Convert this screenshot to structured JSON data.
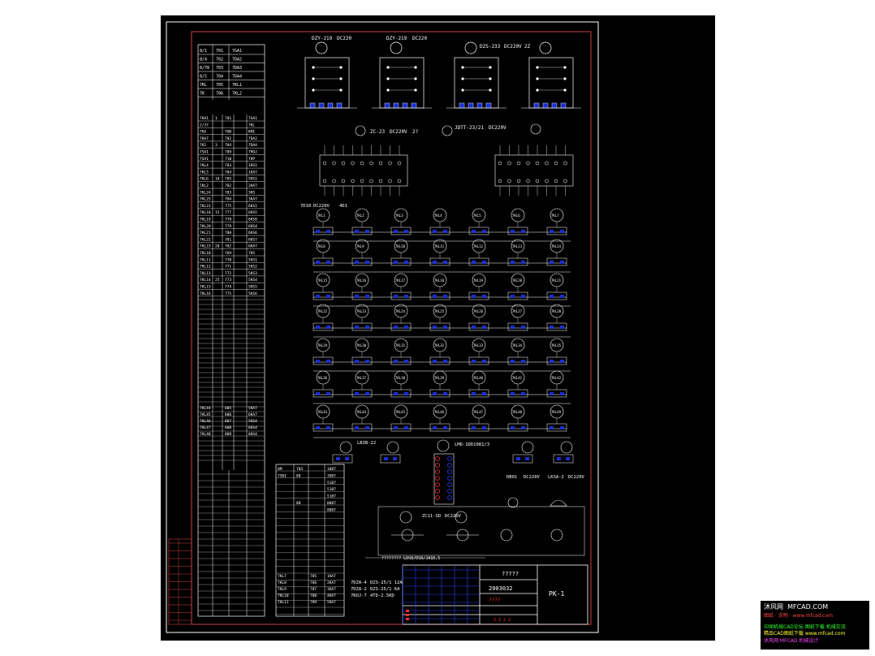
{
  "drawing": {
    "title": "?????",
    "drawing_no": "2003032",
    "sheet_code": "PK-1",
    "revision_marks": [
      "????",
      "2 2 2 2"
    ]
  },
  "relays": {
    "top_types": [
      "DZY-219",
      "DC220",
      "DZY-219",
      "DC220",
      "DZS-233",
      "DC220V",
      "2Z"
    ],
    "mid_types": [
      "ZC-23",
      "DC220V",
      "2?",
      "JDTT-23/21",
      "DC220V"
    ],
    "row_label": [
      "7D10",
      "DC220V",
      "4D1"
    ],
    "bottom_types": [
      "LBIB-22",
      "LMD-1DD1081/3"
    ],
    "bottom_right_types": [
      "DB01",
      "DC220V",
      "LKSA-2",
      "DC220V"
    ],
    "contactor_type": "ZC11-SD",
    "contactor_label": "DC220V",
    "bottom_caption": "???????? LDS8/DS8/JA1D,5"
  },
  "equipment_legend": [
    {
      "tag": "7DZA-4",
      "desc": "DZS-25/1 12A"
    },
    {
      "tag": "7DZA-2",
      "desc": "DZS-25/1 6A"
    },
    {
      "tag": "7ROJ-7",
      "desc": "4TD-2.5RD"
    }
  ],
  "relay_tags": {
    "row1": [
      "7KL1",
      "7KL2",
      "7KL3",
      "7KL4",
      "7KL5",
      "7KL6",
      "7KL7"
    ],
    "row2": [
      "7KL8",
      "7KL9",
      "7KL10",
      "7KL11",
      "7KL12",
      "7KL13",
      "7KL14"
    ],
    "row3": [
      "7KL15",
      "7KL16",
      "7KL17",
      "7KL18",
      "7KL19",
      "7KL20",
      "7KL21"
    ],
    "row4": [
      "7KL22",
      "7KL23",
      "7KL24",
      "7KL25",
      "7KL26",
      "7KL27",
      "7KL28"
    ],
    "row5": [
      "7KL29",
      "7KL30",
      "7KL31",
      "7KL32",
      "7KL33",
      "7KL34",
      "7KL35"
    ],
    "row6": [
      "7KL36",
      "7KL37",
      "7KL38",
      "7KL39",
      "7KL40",
      "7KL41",
      "7KL42"
    ],
    "row7": [
      "7KL43",
      "7KL44",
      "7KL45",
      "7KL46",
      "7KL47",
      "7KL48",
      "7KL49"
    ]
  },
  "terminal_table_rows": [
    [
      "7KA1",
      "1",
      "701",
      "7GA1"
    ],
    [
      "2/37",
      "",
      "",
      "7KL"
    ],
    [
      "7KA",
      "",
      "700",
      "KM1"
    ],
    [
      "7KA7",
      "",
      "702",
      "7DA2"
    ],
    [
      "7K2",
      "3",
      "704",
      "7DA4"
    ],
    [
      "7SA1",
      "",
      "709",
      "7ROJ"
    ],
    [
      "7SA1",
      "",
      "710",
      "7KP"
    ],
    [
      "7KL4",
      "",
      "783",
      "1KS1"
    ],
    [
      "7KL5",
      "",
      "784",
      "1KA7"
    ],
    [
      "7KL6",
      "10",
      "785",
      "5KS1"
    ],
    [
      "7KL2",
      "",
      "782",
      "2KA7"
    ],
    [
      "7KL24",
      "",
      "783",
      "3KS"
    ],
    [
      "7KL25",
      "",
      "784",
      "3KA7"
    ],
    [
      "7KL23",
      "",
      "775",
      "6KS1"
    ],
    [
      "7KL18",
      "15",
      "777",
      "6KS5"
    ],
    [
      "7KL19",
      "",
      "778",
      "6KS8"
    ],
    [
      "7KL20",
      "",
      "779",
      "6KS4"
    ],
    [
      "7KL21",
      "",
      "780",
      "6KS6"
    ],
    [
      "7KL22",
      "",
      "781",
      "6KS7"
    ],
    [
      "7KL23",
      "20",
      "782",
      "6KA7"
    ],
    [
      "7KL10",
      "",
      "769",
      "7KS"
    ],
    [
      "7KL11",
      "",
      "770",
      "5KS1"
    ],
    [
      "7KL12",
      "",
      "771",
      "5KS2"
    ],
    [
      "7KL13",
      "",
      "772",
      "5KS3"
    ],
    [
      "7KL14",
      "25",
      "773",
      "5KS4"
    ],
    [
      "7KL15",
      "",
      "774",
      "5KS5"
    ],
    [
      "7KL16",
      "",
      "775",
      "5KS6"
    ]
  ],
  "left_top_rows": [
    [
      "8/1",
      "701",
      "7GA1"
    ],
    [
      "8/4",
      "702",
      "7DA2"
    ],
    [
      "8/78",
      "703",
      "7DA3"
    ],
    [
      "8/5",
      "704",
      "7DA4"
    ],
    [
      "7KL",
      "705",
      "7KL1"
    ],
    [
      "7K",
      "706",
      "7KL2"
    ]
  ],
  "right_small_table": [
    [
      "8M",
      "703",
      "1887"
    ],
    [
      "7SB1",
      "80",
      "3887"
    ],
    [
      "",
      "",
      "5187"
    ],
    [
      "",
      "",
      "5187"
    ],
    [
      "",
      "",
      "5187"
    ],
    [
      "",
      "80",
      "8887"
    ],
    [
      "",
      "",
      "8887"
    ]
  ],
  "lower_left_rows": [
    [
      "7KL44",
      "",
      "805",
      "5KA7"
    ],
    [
      "7KL45",
      "",
      "806",
      "6KA7"
    ],
    [
      "7KL46",
      "",
      "807",
      "5KS4"
    ],
    [
      "7KL47",
      "",
      "808",
      "6KS4"
    ],
    [
      "7KL48",
      "",
      "809",
      "6KA4"
    ]
  ],
  "lower_right_rows": [
    [
      "7KL7",
      "785",
      "1KA7"
    ],
    [
      "7KL8",
      "786",
      "2KA7"
    ],
    [
      "7KL9",
      "787",
      "3KA7"
    ],
    [
      "7KL10",
      "788",
      "4KA7"
    ],
    [
      "7KL11",
      "789",
      "5KA7"
    ]
  ],
  "watermark": {
    "line1_cn": "沐风网",
    "line1_en": "MFCAD.COM",
    "line2": "图纸 · 说明 · www.mfcad.com",
    "line3": "中国机械CAD论坛 图纸下载 机械交流",
    "line4": "精品CAD图纸下载 www.mfcad.com",
    "line5": "沐风网 MFCAD 机械设计"
  },
  "colors": {
    "background": "#000000",
    "frame": "#ffffff",
    "red_border": "#d04040",
    "wire": "#ffffff",
    "relay_fill": "#1a2fd6",
    "accent_red": "#ff3030",
    "blue": "#2a40ff"
  }
}
